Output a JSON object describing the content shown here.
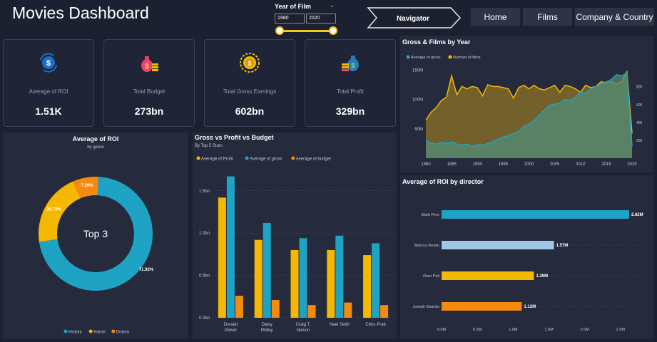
{
  "header": {
    "title": "Movies Dashboard",
    "slicer": {
      "title": "Year of Film",
      "start": "1980",
      "end": "2020"
    },
    "navigator_label": "Navigator",
    "nav_buttons": [
      "Home",
      "Films",
      "Company & Country"
    ]
  },
  "kpis": [
    {
      "label": "Average of ROI",
      "value": "1.51K",
      "icon": "dollar-coin-icon"
    },
    {
      "label": "Total Budget",
      "value": "273bn",
      "icon": "money-bag-icon"
    },
    {
      "label": "Total Gross Earnings",
      "value": "602bn",
      "icon": "gold-coin-icon"
    },
    {
      "label": "Total Profit",
      "value": "329bn",
      "icon": "money-bag-coins-icon"
    }
  ],
  "colors": {
    "blue": "#1fa3c4",
    "yellow": "#f5b800",
    "orange": "#f48a0e",
    "lightblue": "#9fc8e8"
  },
  "chart_data": [
    {
      "type": "pie",
      "title": "Average of ROI",
      "subtitle": "by genre",
      "center_label": "Top 3",
      "categories": [
        "History",
        "Horror",
        "Drama"
      ],
      "values": [
        71.92,
        20.79,
        7.29
      ],
      "labels": [
        "71.92%",
        "20.79%",
        "7.29%"
      ],
      "legend": "bottom"
    },
    {
      "type": "bar",
      "title": "Gross vs Profit vs Budget",
      "subtitle": "By Top 5 Stars",
      "categories": [
        "Donald Glover",
        "Daisy Ridley",
        "Craig T. Nelson",
        "Neel Sethi",
        "Chris Pratt"
      ],
      "series": [
        {
          "name": "Average of Profit",
          "values": [
            1.42,
            0.92,
            0.8,
            0.8,
            0.74
          ]
        },
        {
          "name": "Average of gross",
          "values": [
            1.67,
            1.12,
            0.94,
            0.97,
            0.88
          ]
        },
        {
          "name": "Average of budget",
          "values": [
            0.26,
            0.21,
            0.15,
            0.18,
            0.15
          ]
        }
      ],
      "yticks": [
        "0.0bn",
        "0.5bn",
        "1.0bn",
        "1.5bn"
      ],
      "ylim": [
        0,
        1.7
      ],
      "legend": "top-left"
    },
    {
      "type": "area",
      "title": "Gross & Films by Year",
      "x": [
        1980,
        1981,
        1982,
        1983,
        1984,
        1985,
        1986,
        1987,
        1988,
        1989,
        1990,
        1991,
        1992,
        1993,
        1994,
        1995,
        1996,
        1997,
        1998,
        1999,
        2000,
        2001,
        2002,
        2003,
        2004,
        2005,
        2006,
        2007,
        2008,
        2009,
        2010,
        2011,
        2012,
        2013,
        2014,
        2015,
        2016,
        2017,
        2018,
        2019,
        2020
      ],
      "series": [
        {
          "name": "Average of gross",
          "values": [
            30,
            26,
            24,
            27,
            25,
            28,
            24,
            22,
            24,
            20,
            23,
            22,
            25,
            28,
            32,
            36,
            38,
            42,
            46,
            54,
            58,
            64,
            73,
            82,
            90,
            92,
            94,
            100,
            98,
            104,
            112,
            110,
            118,
            122,
            126,
            130,
            134,
            142,
            140,
            145,
            20
          ]
        },
        {
          "name": "Number of films",
          "values": [
            65,
            78,
            86,
            98,
            104,
            140,
            108,
            122,
            118,
            122,
            120,
            106,
            125,
            122,
            122,
            120,
            118,
            102,
            120,
            124,
            118,
            124,
            118,
            116,
            120,
            124,
            112,
            124,
            122,
            118,
            112,
            124,
            120,
            122,
            130,
            128,
            130,
            126,
            130,
            147,
            42
          ]
        }
      ],
      "xticks": [
        "1980",
        "1985",
        "1990",
        "1995",
        "2000",
        "2005",
        "2010",
        "2015",
        "2020"
      ],
      "yticks": [
        "50M",
        "100M",
        "150M"
      ],
      "ylim": [
        0,
        160
      ],
      "right_ticks": [
        "200",
        "400",
        "600",
        "800"
      ],
      "legend": "top-left"
    },
    {
      "type": "bar",
      "title": "Average of ROI by director",
      "orientation": "horizontal",
      "categories": [
        "Mark Pirro",
        "Marcus Brown",
        "Oren Peli",
        "Joseph Ebanks"
      ],
      "values": [
        2.62,
        1.57,
        1.29,
        1.12
      ],
      "labels": [
        "2.62M",
        "1.57M",
        "1.29M",
        "1.12M"
      ],
      "xticks": [
        "0.0M",
        "0.5M",
        "1.0M",
        "1.5M",
        "2.0M",
        "2.5M"
      ],
      "xlim": [
        0,
        2.75
      ]
    }
  ]
}
